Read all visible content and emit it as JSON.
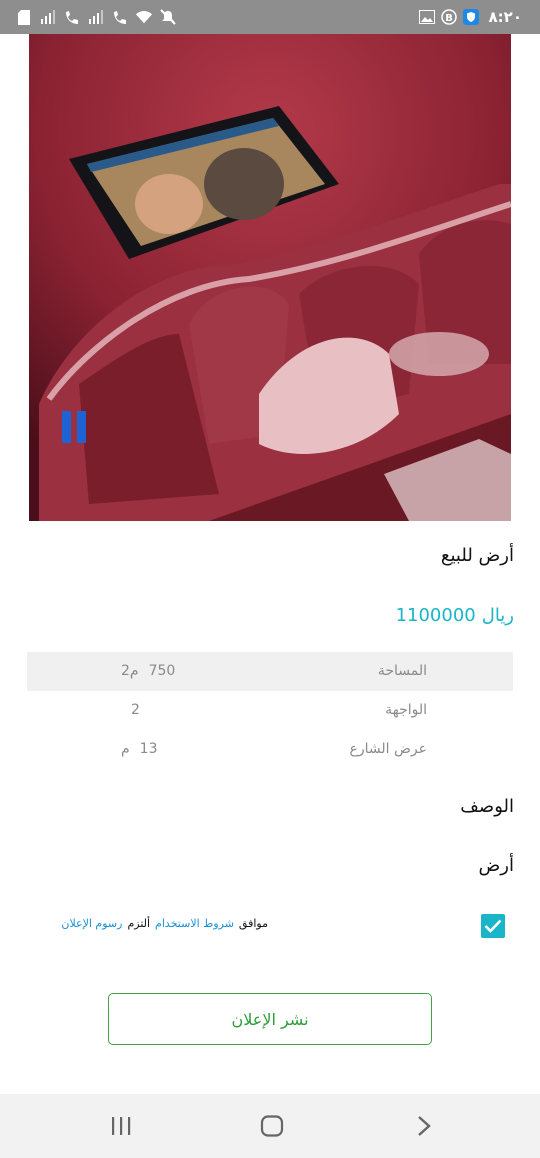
{
  "status_bar": {
    "time": "٨:٢٠",
    "left_icons": [
      "sd-card-icon",
      "signal-icon",
      "wifi-call-icon",
      "signal-icon",
      "wifi-call-icon",
      "wifi-icon",
      "mute-icon"
    ],
    "right_icons": [
      "gallery-icon",
      "b-badge-icon",
      "shield-app-icon"
    ]
  },
  "media": {
    "description_icon": "pause-icon"
  },
  "listing": {
    "title": "أرض للبيع",
    "price_value": "1100000",
    "price_currency": "ريال",
    "specs": [
      {
        "label": "المساحة",
        "value": "750",
        "unit": "م2"
      },
      {
        "label": "الواجهة",
        "value": "2",
        "unit": ""
      },
      {
        "label": "عرض الشارع",
        "value": "13",
        "unit": "م"
      }
    ],
    "description_heading": "الوصف",
    "description_text": "أرض"
  },
  "agreement": {
    "checked": true,
    "agree_label": "موافق",
    "terms_link": "شروط الاستخدام",
    "commit_label": "ألتزم",
    "fees_link": "رسوم الإعلان"
  },
  "publish_button": {
    "label": "نشر الإعلان"
  },
  "colors": {
    "accent": "#1bb5c9",
    "link": "#1a8fd6",
    "button_green": "#43a047",
    "status_bar": "#8e8e8e",
    "pause_blue": "#1e63d6"
  }
}
